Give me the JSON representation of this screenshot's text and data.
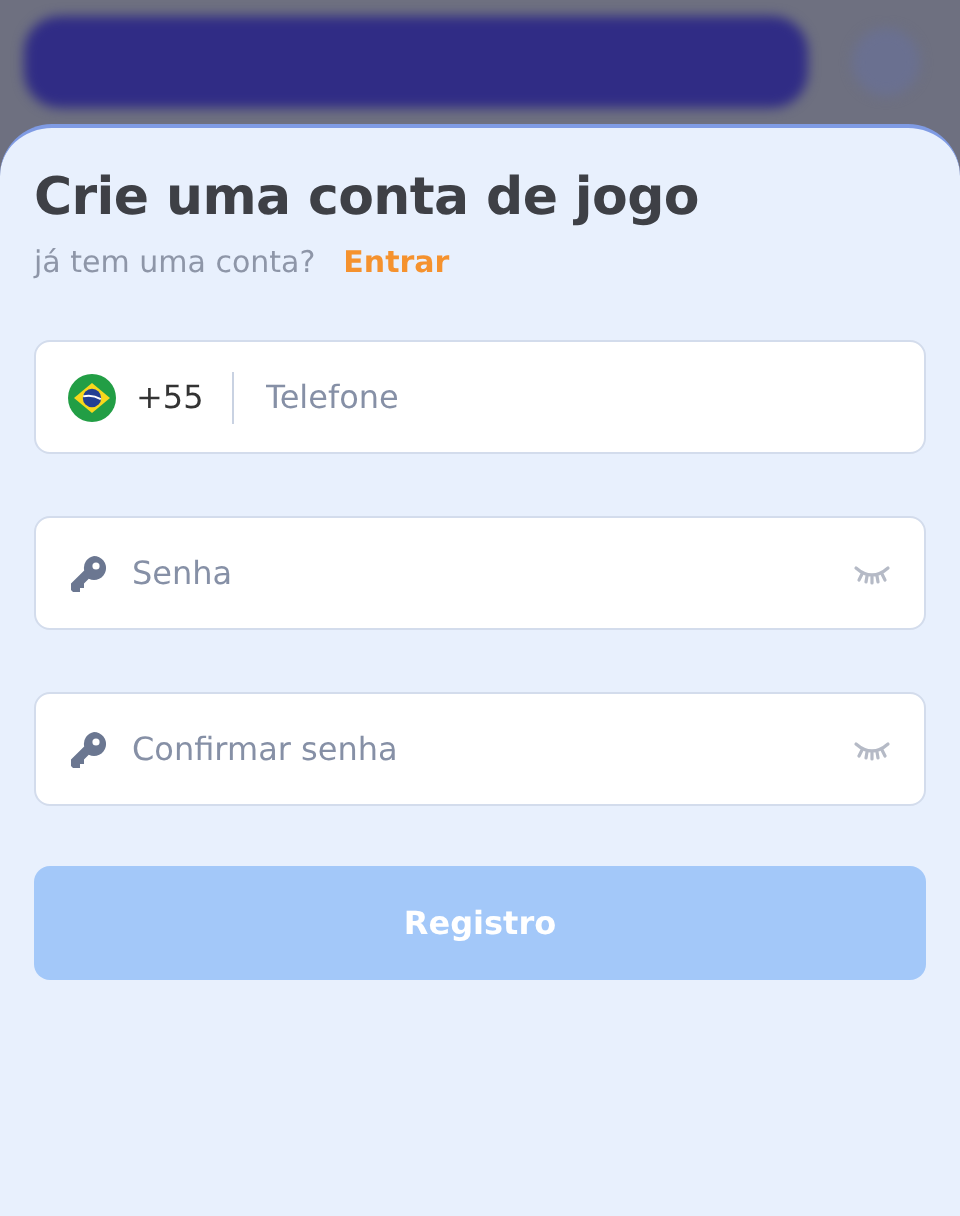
{
  "title": "Crie uma conta de jogo",
  "subtitle": {
    "text": "já tem uma conta?",
    "link": "Entrar"
  },
  "fields": [
    {
      "kind": "phone",
      "code": "+55",
      "placeholder": "Telefone"
    },
    {
      "kind": "password",
      "placeholder": "Senha"
    },
    {
      "kind": "password",
      "placeholder": "Confirmar senha"
    }
  ],
  "submit": {
    "label": "Registro",
    "disabled": true
  }
}
